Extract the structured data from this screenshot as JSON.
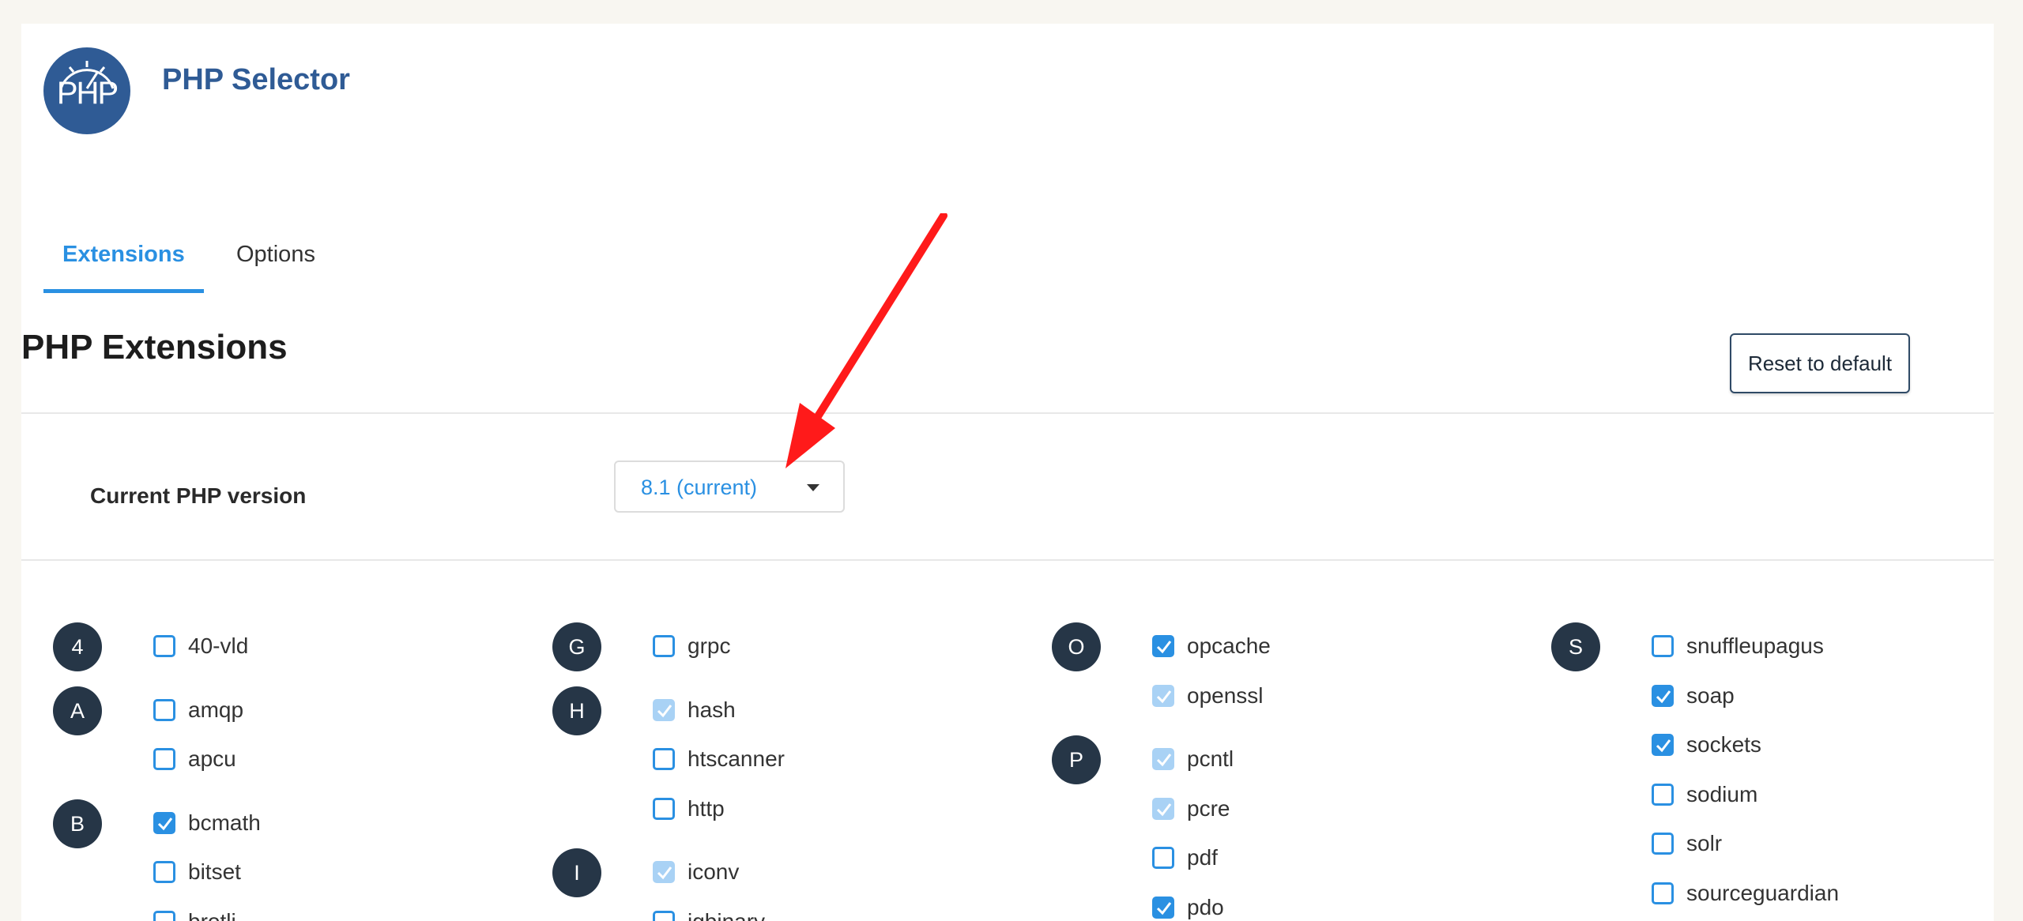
{
  "app": {
    "title": "PHP Selector",
    "logo_text": "PHP"
  },
  "tabs": [
    {
      "label": "Extensions",
      "active": true
    },
    {
      "label": "Options",
      "active": false
    }
  ],
  "section": {
    "title": "PHP Extensions",
    "reset_label": "Reset to default",
    "version_label": "Current PHP version",
    "version_value": "8.1 (current)"
  },
  "colors": {
    "accent": "#2a90e2",
    "brand": "#2f5b95",
    "badge": "#263647",
    "locked": "#a9d2f5",
    "annotation_arrow": "#ff1a1a"
  },
  "columns": [
    {
      "groups": [
        {
          "letter": "4",
          "items": [
            {
              "name": "40-vld",
              "state": "unchecked"
            }
          ]
        },
        {
          "letter": "A",
          "items": [
            {
              "name": "amqp",
              "state": "unchecked"
            },
            {
              "name": "apcu",
              "state": "unchecked"
            }
          ]
        },
        {
          "letter": "B",
          "items": [
            {
              "name": "bcmath",
              "state": "checked"
            },
            {
              "name": "bitset",
              "state": "unchecked"
            },
            {
              "name": "brotli",
              "state": "unchecked"
            }
          ]
        }
      ]
    },
    {
      "groups": [
        {
          "letter": "G",
          "items": [
            {
              "name": "grpc",
              "state": "unchecked"
            }
          ]
        },
        {
          "letter": "H",
          "items": [
            {
              "name": "hash",
              "state": "locked"
            },
            {
              "name": "htscanner",
              "state": "unchecked"
            },
            {
              "name": "http",
              "state": "unchecked"
            }
          ]
        },
        {
          "letter": "I",
          "items": [
            {
              "name": "iconv",
              "state": "locked"
            },
            {
              "name": "igbinary",
              "state": "unchecked"
            }
          ]
        }
      ]
    },
    {
      "groups": [
        {
          "letter": "O",
          "items": [
            {
              "name": "opcache",
              "state": "checked"
            },
            {
              "name": "openssl",
              "state": "locked"
            }
          ]
        },
        {
          "letter": "P",
          "items": [
            {
              "name": "pcntl",
              "state": "locked"
            },
            {
              "name": "pcre",
              "state": "locked"
            },
            {
              "name": "pdf",
              "state": "unchecked"
            },
            {
              "name": "pdo",
              "state": "checked"
            }
          ]
        }
      ]
    },
    {
      "groups": [
        {
          "letter": "S",
          "items": [
            {
              "name": "snuffleupagus",
              "state": "unchecked"
            },
            {
              "name": "soap",
              "state": "checked"
            },
            {
              "name": "sockets",
              "state": "checked"
            },
            {
              "name": "sodium",
              "state": "unchecked"
            },
            {
              "name": "solr",
              "state": "unchecked"
            },
            {
              "name": "sourceguardian",
              "state": "unchecked"
            },
            {
              "name": "",
              "state": "locked"
            }
          ]
        }
      ]
    }
  ]
}
